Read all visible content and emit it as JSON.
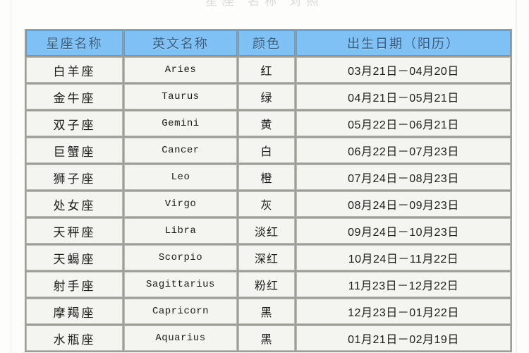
{
  "page": {
    "top_remnant_text": "星座 名称 对照",
    "background_color": "#fdfdfc"
  },
  "colors": {
    "header_background": "#7fc0f5",
    "header_text": "#2f5d86",
    "cell_background": "#f4f5f1",
    "cell_text": "#1b1b1b",
    "grid_line": "#9d9d95",
    "cell_border": "#b9bab4"
  },
  "table": {
    "headers": [
      "星座名称",
      "英文名称",
      "颜色",
      "出生日期（阳历）"
    ],
    "rows": [
      {
        "name": "白羊座",
        "english": "Aries",
        "color": "红",
        "dates": "03月21日－04月20日"
      },
      {
        "name": "金牛座",
        "english": "Taurus",
        "color": "绿",
        "dates": "04月21日－05月21日"
      },
      {
        "name": "双子座",
        "english": "Gemini",
        "color": "黄",
        "dates": "05月22日－06月21日"
      },
      {
        "name": "巨蟹座",
        "english": "Cancer",
        "color": "白",
        "dates": "06月22日－07月23日"
      },
      {
        "name": "狮子座",
        "english": "Leo",
        "color": "橙",
        "dates": "07月24日－08月23日"
      },
      {
        "name": "处女座",
        "english": "Virgo",
        "color": "灰",
        "dates": "08月24日－09月23日"
      },
      {
        "name": "天秤座",
        "english": "Libra",
        "color": "淡红",
        "dates": "09月24日－10月23日"
      },
      {
        "name": "天蝎座",
        "english": "Scorpio",
        "color": "深红",
        "dates": "10月24日－11月22日"
      },
      {
        "name": "射手座",
        "english": "Sagittarius",
        "color": "粉红",
        "dates": "11月23日－12月22日"
      },
      {
        "name": "摩羯座",
        "english": "Capricorn",
        "color": "黑",
        "dates": "12月23日－01月22日"
      },
      {
        "name": "水瓶座",
        "english": "Aquarius",
        "color": "黑",
        "dates": "01月21日－02月19日"
      }
    ]
  }
}
